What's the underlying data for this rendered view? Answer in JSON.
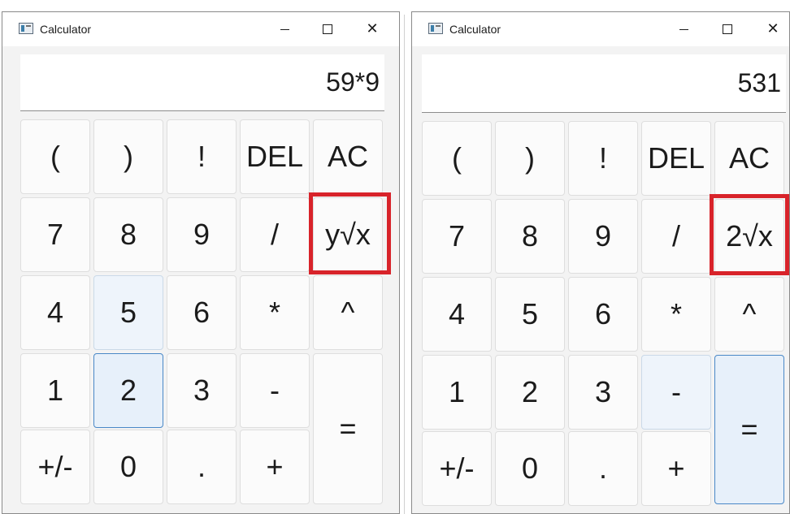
{
  "colors": {
    "window_bg": "#f3f3f3",
    "key_bg": "#fbfbfb",
    "key_active_bg": "#e7f0fa",
    "focus_border": "#4a88c7",
    "annotation_red": "#d8232a"
  },
  "left_window": {
    "title": "Calculator",
    "display": "59*9",
    "keys": {
      "lparen": "(",
      "rparen": ")",
      "factorial": "!",
      "del": "DEL",
      "ac": "AC",
      "seven": "7",
      "eight": "8",
      "nine": "9",
      "divide": "/",
      "root": "y√x",
      "four": "4",
      "five": "5",
      "six": "6",
      "multiply": "*",
      "power": "^",
      "one": "1",
      "two": "2",
      "three": "3",
      "minus": "-",
      "equals": "=",
      "negate": "+/-",
      "zero": "0",
      "dot": ".",
      "plus": "+"
    }
  },
  "right_window": {
    "title": "Calculator",
    "display": "531",
    "keys": {
      "lparen": "(",
      "rparen": ")",
      "factorial": "!",
      "del": "DEL",
      "ac": "AC",
      "seven": "7",
      "eight": "8",
      "nine": "9",
      "divide": "/",
      "root": "2√x",
      "four": "4",
      "five": "5",
      "six": "6",
      "multiply": "*",
      "power": "^",
      "one": "1",
      "two": "2",
      "three": "3",
      "minus": "-",
      "equals": "=",
      "negate": "+/-",
      "zero": "0",
      "dot": ".",
      "plus": "+"
    }
  }
}
